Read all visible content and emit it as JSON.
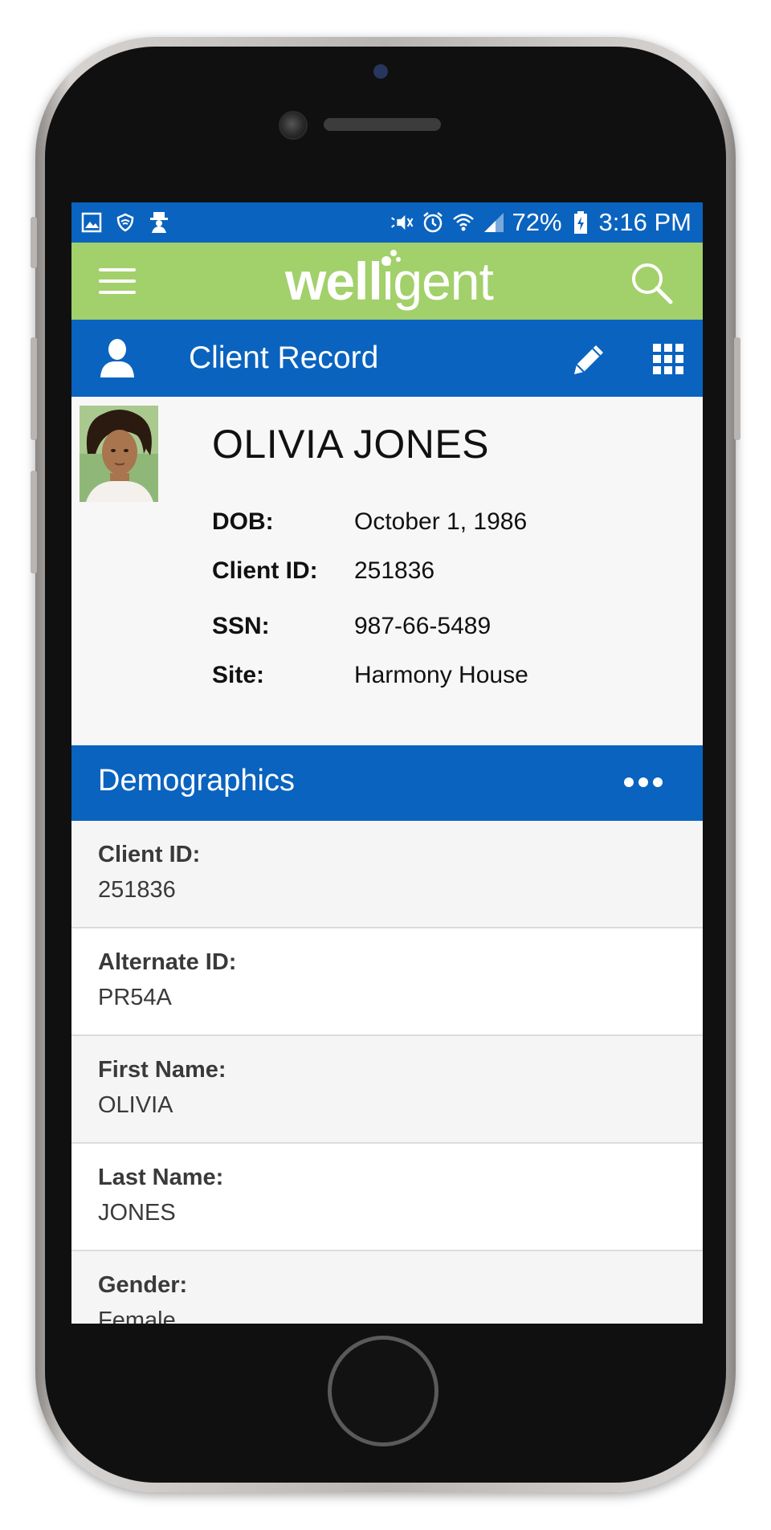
{
  "status_bar": {
    "battery_percent": "72%",
    "time": "3:16 PM",
    "left_icons": [
      "gallery-icon",
      "vpn-shield-icon",
      "spy-icon"
    ],
    "right_icons": [
      "mute-icon",
      "alarm-icon",
      "wifi-icon",
      "signal-icon",
      "battery-charging-icon"
    ]
  },
  "top_bar": {
    "logo_bold": "well",
    "logo_light": "igent",
    "menu_icon": "hamburger-icon",
    "search_icon": "search-icon"
  },
  "record_bar": {
    "title": "Client Record",
    "icons": [
      "person-icon",
      "pencil-icon",
      "apps-grid-icon"
    ]
  },
  "client": {
    "name": "OLIVIA JONES",
    "info": [
      {
        "label": "DOB:",
        "value": "October 1, 1986"
      },
      {
        "label": "Client ID:",
        "value": "251836"
      },
      {
        "label": "SSN:",
        "value": "987-66-5489"
      },
      {
        "label": "Site:",
        "value": "Harmony House"
      }
    ]
  },
  "demographics": {
    "title": "Demographics",
    "more_icon": "more-horizontal-icon",
    "fields": [
      {
        "label": "Client ID:",
        "value": "251836"
      },
      {
        "label": "Alternate ID:",
        "value": "PR54A"
      },
      {
        "label": "First Name:",
        "value": "OLIVIA"
      },
      {
        "label": "Last Name:",
        "value": "JONES"
      },
      {
        "label": "Gender:",
        "value": "Female"
      }
    ]
  },
  "colors": {
    "primary_blue": "#0a63bf",
    "brand_green": "#a2d06b"
  }
}
